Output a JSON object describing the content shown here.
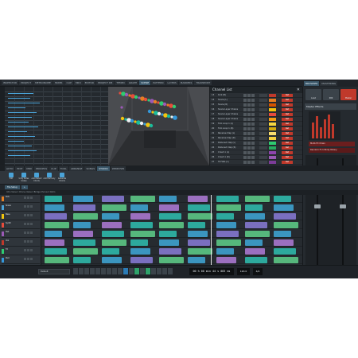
{
  "top_tabs": [
    "INSPECTOR",
    "PROJECT",
    "METRONOME",
    "MIXER",
    "CLIP",
    "MIDI",
    "EDITOR",
    "PROJECT DB",
    "TEMPO",
    "GRAPH",
    "SCENE",
    "PATTERN",
    "LAYERS",
    "MARKERS",
    "TRANSPORT"
  ],
  "right_tabs": [
    "BROWSER",
    "MASTERING"
  ],
  "channel_list": {
    "title": "Channel List",
    "close": "✕",
    "rows": [
      {
        "n": "13",
        "name": "Kick (B)",
        "color": "#c0392b"
      },
      {
        "n": "14",
        "name": "Snare (L)",
        "color": "#e67e22"
      },
      {
        "n": "15",
        "name": "Snare (R)",
        "color": "#d35400"
      },
      {
        "n": "16",
        "name": "Snare Layer Chains",
        "color": "#f1c40f"
      },
      {
        "n": "17",
        "name": "Snare Layer Chains",
        "color": "#e74c3c"
      },
      {
        "n": "18",
        "name": "Snare Layer Chains",
        "color": "#f39c12"
      },
      {
        "n": "19",
        "name": "Tom Loop 1 (L)",
        "color": "#f5d742"
      },
      {
        "n": "20",
        "name": "Tom Loop 1 (R)",
        "color": "#d4ac0d"
      },
      {
        "n": "21",
        "name": "Reverse Clap (L)",
        "color": "#f7dc6f"
      },
      {
        "n": "22",
        "name": "Reverse Clap (R)",
        "color": "#f4d03f"
      },
      {
        "n": "23",
        "name": "Detuned Clap (L)",
        "color": "#2ecc71"
      },
      {
        "n": "24",
        "name": "Detuned Clap (R)",
        "color": "#27ae60"
      },
      {
        "n": "25",
        "name": "Crash 1 (L)",
        "color": "#8e44ad"
      },
      {
        "n": "26",
        "name": "Crash 1 (R)",
        "color": "#9b59b6"
      },
      {
        "n": "27",
        "name": "Hi Hats (L)",
        "color": "#7d3c98"
      }
    ],
    "return_label": "Ret"
  },
  "right_panel": {
    "buttons": [
      {
        "label": "Load",
        "red": false
      },
      {
        "label": "000",
        "red": false
      },
      {
        "label": "Master",
        "red": true
      }
    ],
    "info": "Master Effects",
    "plugin1": "Multi-FX Chain",
    "plugin2": "Random Fx Infinity Rotary",
    "bottom": "Output Filters"
  },
  "ribbon_tabs": [
    "AUTO",
    "EDIT",
    "MIDI",
    "PROCESS",
    "CLIP",
    "TOOL",
    "ARRANGE",
    "SONGS",
    "STUDIO",
    "WINDOWS"
  ],
  "ribbon_buttons": [
    "Edit",
    "Unify Notes Scales",
    "Auto Detect Chords",
    "Add Harmony",
    "Generate Chords"
  ],
  "doc_tabs": [
    "File Setup",
    "+"
  ],
  "ruler": "Intro     Verse 1     Chorus     Verse 2     Bridge     Chorus 2     Outro",
  "tracks": [
    {
      "name": "Kick",
      "color": "#e67e22"
    },
    {
      "name": "Snare",
      "color": "#4aa3d8"
    },
    {
      "name": "Bass",
      "color": "#f1c40f"
    },
    {
      "name": "Synth",
      "color": "#e74c3c"
    },
    {
      "name": "Pad",
      "color": "#9b59b6"
    },
    {
      "name": "Vox",
      "color": "#c0392b"
    },
    {
      "name": "FX",
      "color": "#2ecc71"
    },
    {
      "name": "Perc",
      "color": "#3498db"
    }
  ],
  "status": {
    "preset": "Default",
    "timecode": "00 h 00 min 44 s 083 ms",
    "tempo": "120.0",
    "signature": "4/4"
  }
}
